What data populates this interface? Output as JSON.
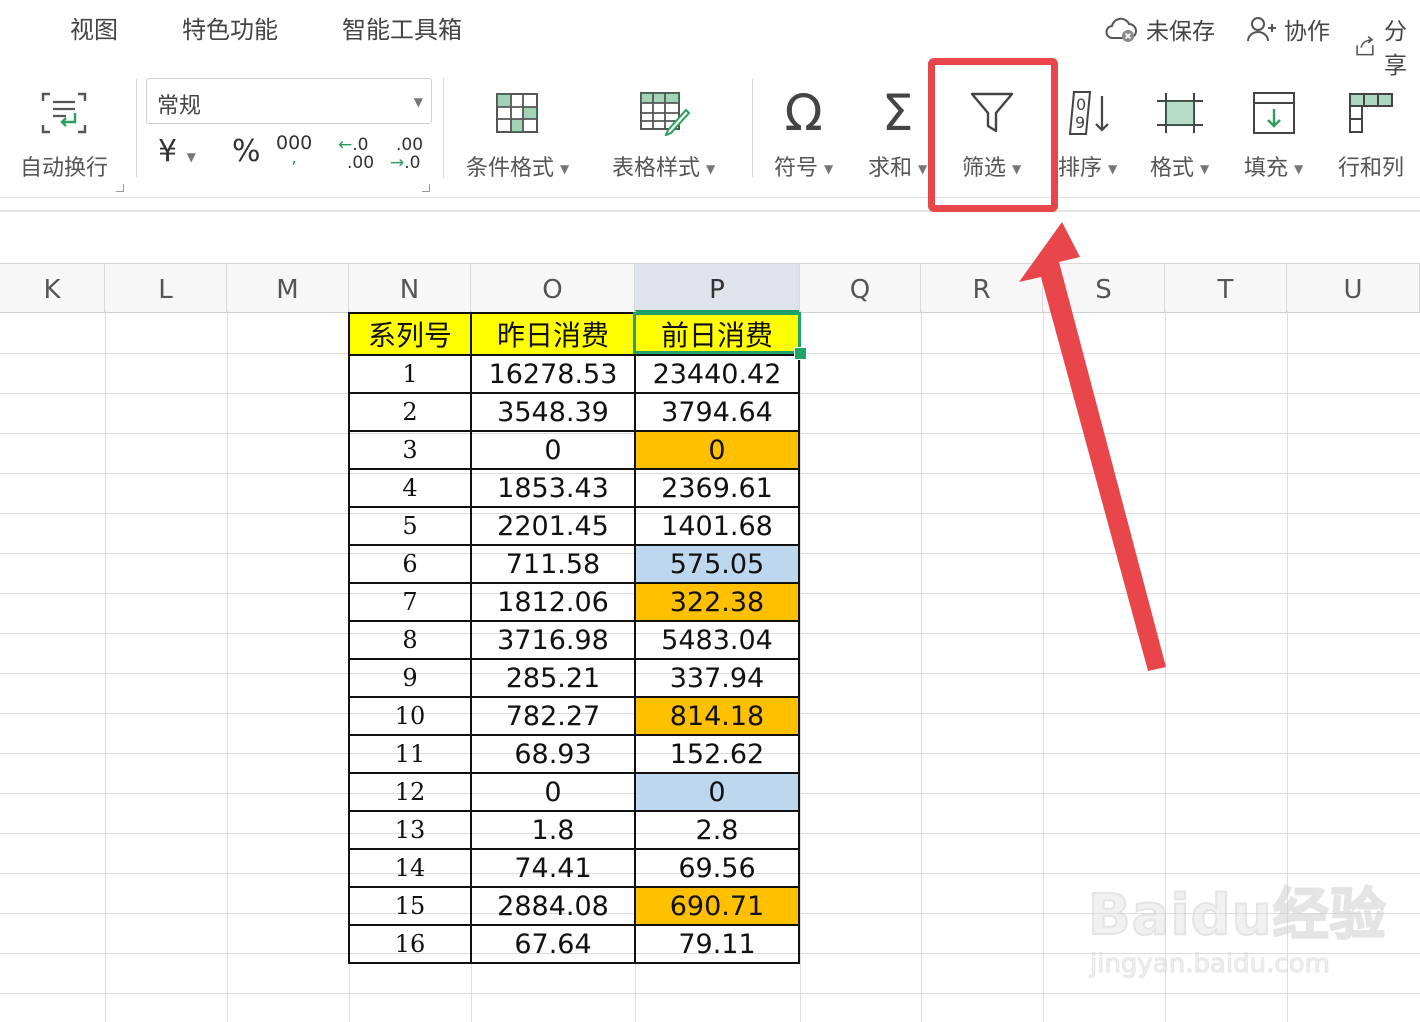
{
  "menu": {
    "tabs": [
      "视图",
      "特色功能",
      "智能工具箱"
    ]
  },
  "top_right": {
    "unsaved": "未保存",
    "collab": "协作",
    "share": "分享"
  },
  "ribbon": {
    "wrap_text": "自动换行",
    "number_format": "常规",
    "currency_symbol": "¥",
    "percent_symbol": "%",
    "thousands_symbol": "000",
    "decrease_decimal": ".00",
    "increase_decimal": ".0",
    "conditional_format": "条件格式",
    "table_style": "表格样式",
    "symbol": "符号",
    "sum": "求和",
    "filter": "筛选",
    "sort": "排序",
    "format": "格式",
    "fill": "填充",
    "rows_cols": "行和列"
  },
  "sheet": {
    "columns": [
      "K",
      "L",
      "M",
      "N",
      "O",
      "P",
      "Q",
      "R",
      "S",
      "T",
      "U"
    ],
    "selected_column": "P",
    "table_headers": [
      "系列号",
      "昨日消费",
      "前日消费"
    ],
    "rows": [
      [
        "1",
        "16278.53",
        "23440.42"
      ],
      [
        "2",
        "3548.39",
        "3794.64"
      ],
      [
        "3",
        "0",
        "0"
      ],
      [
        "4",
        "1853.43",
        "2369.61"
      ],
      [
        "5",
        "2201.45",
        "1401.68"
      ],
      [
        "6",
        "711.58",
        "575.05"
      ],
      [
        "7",
        "1812.06",
        "322.38"
      ],
      [
        "8",
        "3716.98",
        "5483.04"
      ],
      [
        "9",
        "285.21",
        "337.94"
      ],
      [
        "10",
        "782.27",
        "814.18"
      ],
      [
        "11",
        "68.93",
        "152.62"
      ],
      [
        "12",
        "0",
        "0"
      ],
      [
        "13",
        "1.8",
        "2.8"
      ],
      [
        "14",
        "74.41",
        "69.56"
      ],
      [
        "15",
        "2884.08",
        "690.71"
      ],
      [
        "16",
        "67.64",
        "79.11"
      ]
    ],
    "cell_fills": [
      "",
      "",
      "orange",
      "",
      "",
      "blue",
      "orange",
      "",
      "",
      "orange",
      "",
      "blue",
      "",
      "",
      "orange",
      ""
    ]
  },
  "colors": {
    "orange": "#ffc000",
    "blue": "#bdd7ee",
    "header_yellow": "#ffff00",
    "annotation_red": "#e8464a",
    "selection_green": "#1fa56a"
  },
  "watermark": {
    "logo": "Baidu经验",
    "url": "jingyan.baidu.com"
  }
}
